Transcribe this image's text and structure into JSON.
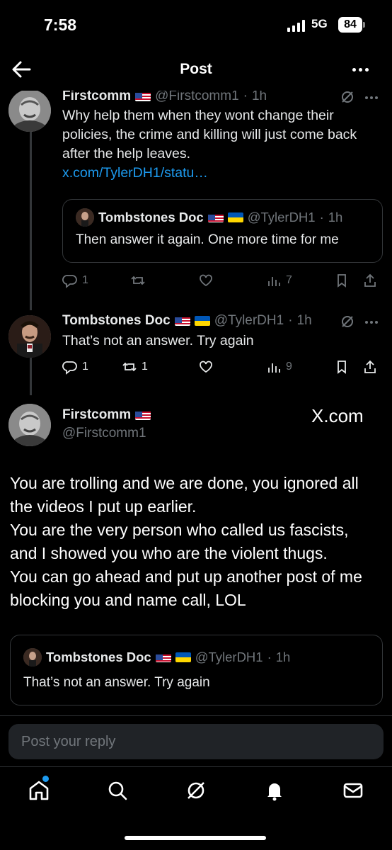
{
  "status_bar": {
    "time": "7:58",
    "network": "5G",
    "battery": "84"
  },
  "header": {
    "title": "Post"
  },
  "thread": {
    "reply1": {
      "name": "Firstcomm",
      "handle": "@Firstcomm1",
      "separator": "·",
      "ago": "1h",
      "text": "Why help them when they wont change their policies, the crime and killing will just come back after the help leaves.",
      "link": "x.com/TylerDH1/statu…",
      "quote": {
        "name": "Tombstones Doc",
        "handle": "@TylerDH1",
        "separator": "·",
        "ago": "1h",
        "text": "Then answer it again. One more time for me"
      },
      "actions": {
        "replies": "1",
        "reposts": "",
        "likes": "",
        "views": "7"
      }
    },
    "reply2": {
      "name": "Tombstones Doc",
      "handle": "@TylerDH1",
      "separator": "·",
      "ago": "1h",
      "text": "That’s not an answer. Try again",
      "actions": {
        "replies": "1",
        "reposts": "1",
        "likes": "",
        "views": "9"
      }
    },
    "main": {
      "name": "Firstcomm",
      "handle": "@Firstcomm1",
      "source": "X.com",
      "text_lines": [
        "You are trolling and we are done, you ignored all",
        "the videos I put up earlier.",
        "You are the very person who called us fascists,",
        "and I showed you who are the violent thugs.",
        "You can go ahead and put up another post of me",
        "blocking you and name call, LOL"
      ],
      "quote": {
        "name": "Tombstones Doc",
        "handle": "@TylerDH1",
        "separator": "·",
        "ago": "1h",
        "text": "That’s not an answer. Try again"
      }
    }
  },
  "reply_input": {
    "placeholder": "Post your reply"
  },
  "tabs": [
    {
      "icon": "home-icon"
    },
    {
      "icon": "search-icon"
    },
    {
      "icon": "grok-icon"
    },
    {
      "icon": "notifications-icon"
    },
    {
      "icon": "messages-icon"
    }
  ],
  "colors": {
    "background": "#000000",
    "link": "#1d9bf0",
    "muted": "#71767b",
    "divider": "#2f3336"
  }
}
